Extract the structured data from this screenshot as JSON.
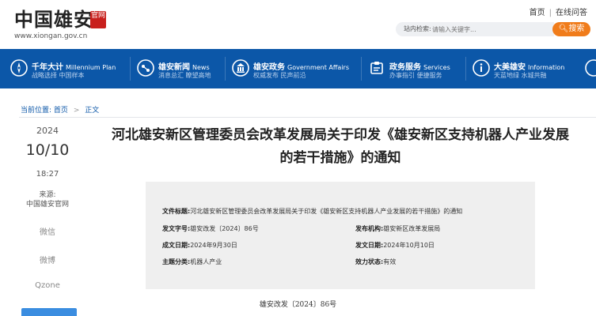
{
  "header": {
    "logo_text": "中国雄安",
    "logo_seal": "官网",
    "logo_url": "www.xiongan.gov.cn",
    "links": [
      "首页",
      "在线问答"
    ],
    "search_label": "站内检索:",
    "search_placeholder": "请输入关键字...",
    "search_button": "搜索"
  },
  "nav": [
    {
      "title": "千年大计",
      "en": "Millennium Plan",
      "sub": "战略选择 中国样本",
      "icon": "compass-icon"
    },
    {
      "title": "雄安新闻",
      "en": "News",
      "sub": "消息总汇 瞭望高地",
      "icon": "globe-icon"
    },
    {
      "title": "雄安政务",
      "en": "Government Affairs",
      "sub": "权威发布 民声前沿",
      "icon": "government-icon"
    },
    {
      "title": "政务服务",
      "en": "Services",
      "sub": "办事指引 便捷服务",
      "icon": "services-icon"
    },
    {
      "title": "大美雄安",
      "en": "Information",
      "sub": "天蓝地绿 水城共融",
      "icon": "info-icon"
    }
  ],
  "breadcrumb": {
    "label": "当前位置:",
    "items": [
      "首页",
      "正文"
    ]
  },
  "sidebar": {
    "year": "2024",
    "date": "10/10",
    "time": "18:27",
    "source_label": "来源:",
    "source": "中国雄安官网",
    "share": [
      "微信",
      "微博",
      "Qzone"
    ]
  },
  "article": {
    "title": "河北雄安新区管理委员会改革发展局关于印发《雄安新区支持机器人产业发展的若干措施》的通知",
    "doc_number": "雄安改发〔2024〕86号"
  },
  "info": {
    "file_title_label": "文件标题:",
    "file_title": "河北雄安新区管理委员会改革发展局关于印发《雄安新区支持机器人产业发展的若干措施》的通知",
    "doc_no_label": "发文字号:",
    "doc_no": "雄安改发〔2024〕86号",
    "issuer_label": "发布机构:",
    "issuer": "雄安新区改革发展局",
    "created_label": "成文日期:",
    "created": "2024年9月30日",
    "published_label": "发文日期:",
    "published": "2024年10月10日",
    "subject_label": "主题分类:",
    "subject": "机器人产业",
    "status_label": "效力状态:",
    "status": "有效"
  },
  "colors": {
    "nav_bg": "#0c57a8",
    "accent": "#f07c1b",
    "seal": "#c8201d"
  }
}
